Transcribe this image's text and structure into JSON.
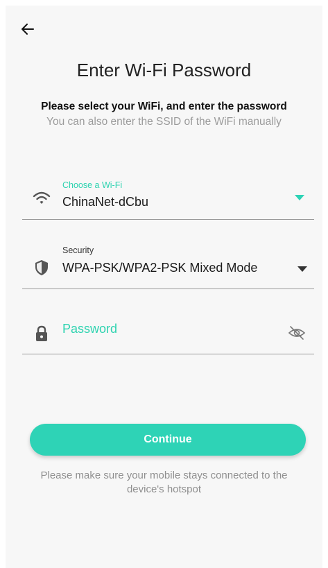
{
  "colors": {
    "accent": "#2ed3b6",
    "background": "#f7f7f7",
    "text": "#1a1a1a",
    "muted": "#9b9b9b"
  },
  "header": {
    "back_icon": "arrow-left-icon",
    "title": "Enter Wi-Fi Password",
    "subtitle": "Please select your WiFi, and enter the password",
    "hint": "You can also enter the SSID of the WiFi manually"
  },
  "form": {
    "wifi": {
      "icon": "wifi-icon",
      "label": "Choose a Wi-Fi",
      "value": "ChinaNet-dCbu"
    },
    "security": {
      "icon": "shield-icon",
      "label": "Security",
      "value": "WPA-PSK/WPA2-PSK Mixed Mode"
    },
    "password": {
      "icon": "lock-icon",
      "placeholder": "Password",
      "value": "",
      "visibility_icon": "eye-off-icon"
    }
  },
  "actions": {
    "continue_label": "Continue"
  },
  "footer": {
    "note": "Please make sure your mobile stays connected to the device's hotspot"
  }
}
